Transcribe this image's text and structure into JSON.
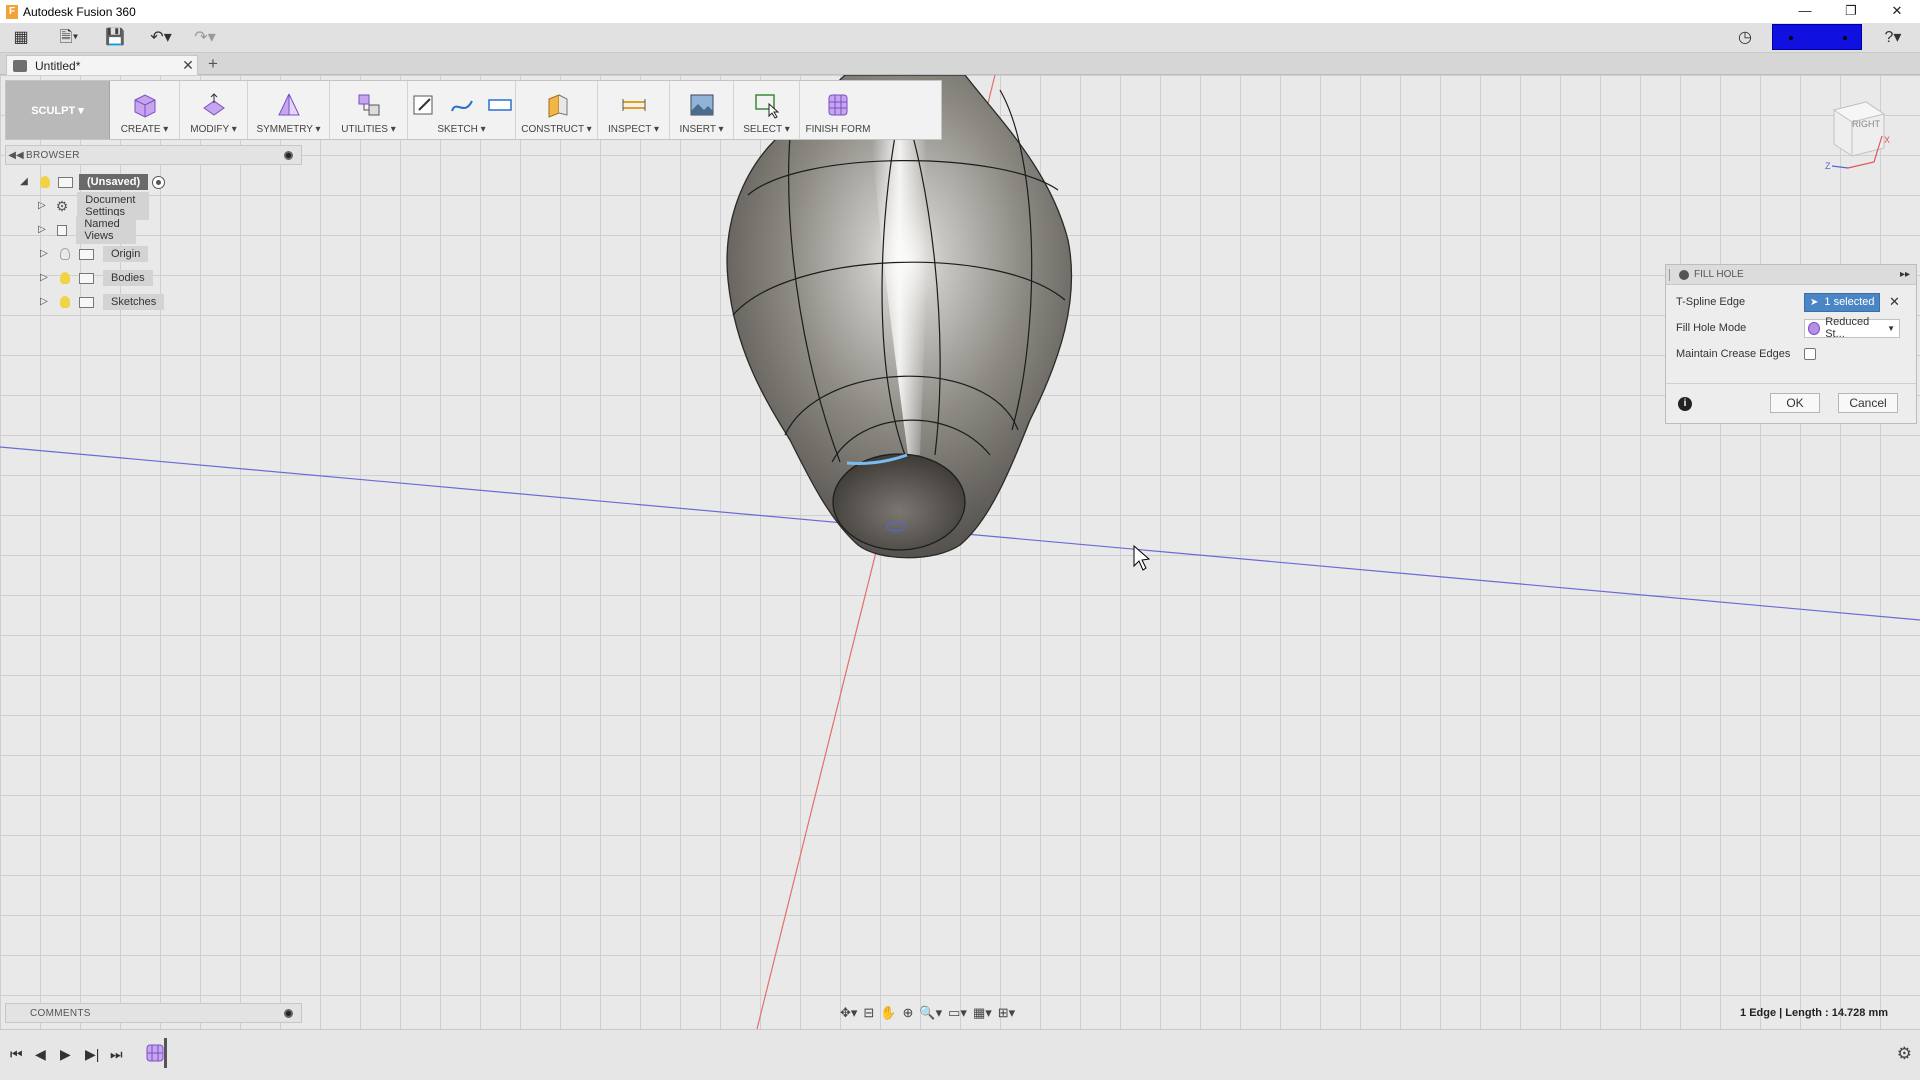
{
  "window": {
    "title": "Autodesk Fusion 360",
    "controls": [
      "—",
      "❐",
      "✕"
    ]
  },
  "document": {
    "tab_name": "Untitled*"
  },
  "ribbon": {
    "workspace": "SCULPT ▾",
    "groups": [
      {
        "label": "CREATE ▾"
      },
      {
        "label": "MODIFY ▾"
      },
      {
        "label": "SYMMETRY ▾"
      },
      {
        "label": "UTILITIES ▾"
      },
      {
        "label": "SKETCH ▾"
      },
      {
        "label": "CONSTRUCT ▾"
      },
      {
        "label": "INSPECT ▾"
      },
      {
        "label": "INSERT ▾"
      },
      {
        "label": "SELECT ▾"
      },
      {
        "label": "FINISH FORM"
      }
    ]
  },
  "browser": {
    "header": "BROWSER",
    "root": "(Unsaved)",
    "items": [
      {
        "label": "Document Settings"
      },
      {
        "label": "Named Views"
      },
      {
        "label": "Origin"
      },
      {
        "label": "Bodies"
      },
      {
        "label": "Sketches"
      }
    ]
  },
  "viewcube": {
    "face": "RIGHT",
    "axis_z": "Z",
    "axis_x": "X"
  },
  "fill_hole": {
    "title": "FILL HOLE",
    "edge_label": "T-Spline Edge",
    "edge_value": "1 selected",
    "mode_label": "Fill Hole Mode",
    "mode_value": "Reduced St...",
    "crease_label": "Maintain Crease Edges",
    "ok": "OK",
    "cancel": "Cancel"
  },
  "comments": {
    "header": "COMMENTS"
  },
  "status": {
    "readout": "1 Edge | Length : 14.728 mm"
  },
  "colors": {
    "accent": "#4a86c5",
    "user_box": "#1010e0",
    "model": "#8d8a84"
  }
}
